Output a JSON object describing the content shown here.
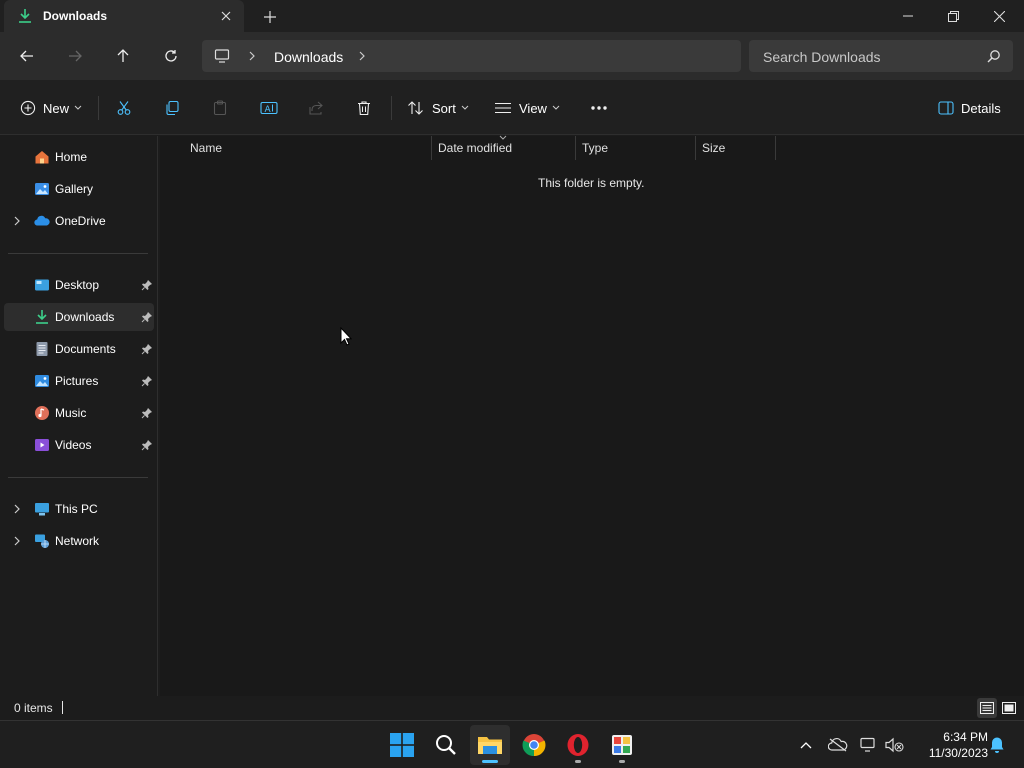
{
  "window": {
    "tab_title": "Downloads",
    "controls": {
      "minimize": "minimize",
      "maximize": "restore",
      "close": "close"
    }
  },
  "address_bar": {
    "crumbs": [
      "Downloads"
    ]
  },
  "search": {
    "placeholder": "Search Downloads"
  },
  "command_bar": {
    "new_label": "New",
    "sort_label": "Sort",
    "view_label": "View",
    "details_label": "Details",
    "icons": [
      "cut-icon",
      "copy-icon",
      "paste-icon",
      "rename-icon",
      "share-icon",
      "delete-icon",
      "more-icon"
    ]
  },
  "sidebar": {
    "items": [
      {
        "label": "Home",
        "icon": "home-icon"
      },
      {
        "label": "Gallery",
        "icon": "gallery-icon"
      },
      {
        "label": "OneDrive",
        "icon": "onedrive-icon"
      },
      {
        "label": "Desktop",
        "icon": "desktop-icon"
      },
      {
        "label": "Downloads",
        "icon": "downloads-icon",
        "selected": true
      },
      {
        "label": "Documents",
        "icon": "documents-icon"
      },
      {
        "label": "Pictures",
        "icon": "pictures-icon"
      },
      {
        "label": "Music",
        "icon": "music-icon"
      },
      {
        "label": "Videos",
        "icon": "videos-icon"
      },
      {
        "label": "This PC",
        "icon": "this-pc-icon"
      },
      {
        "label": "Network",
        "icon": "network-icon"
      }
    ]
  },
  "content": {
    "columns": [
      "Name",
      "Date modified",
      "Type",
      "Size"
    ],
    "empty_message": "This folder is empty."
  },
  "status_bar": {
    "item_count": "0 items"
  },
  "taskbar": {
    "apps": [
      "start",
      "search",
      "file-explorer",
      "chrome",
      "opera",
      "paint"
    ],
    "clock_time": "6:34 PM",
    "clock_date": "11/30/2023"
  },
  "colors": {
    "accent": "#4cc2ff",
    "download_green": "#3ccf8a",
    "window_bg": "#191919"
  }
}
